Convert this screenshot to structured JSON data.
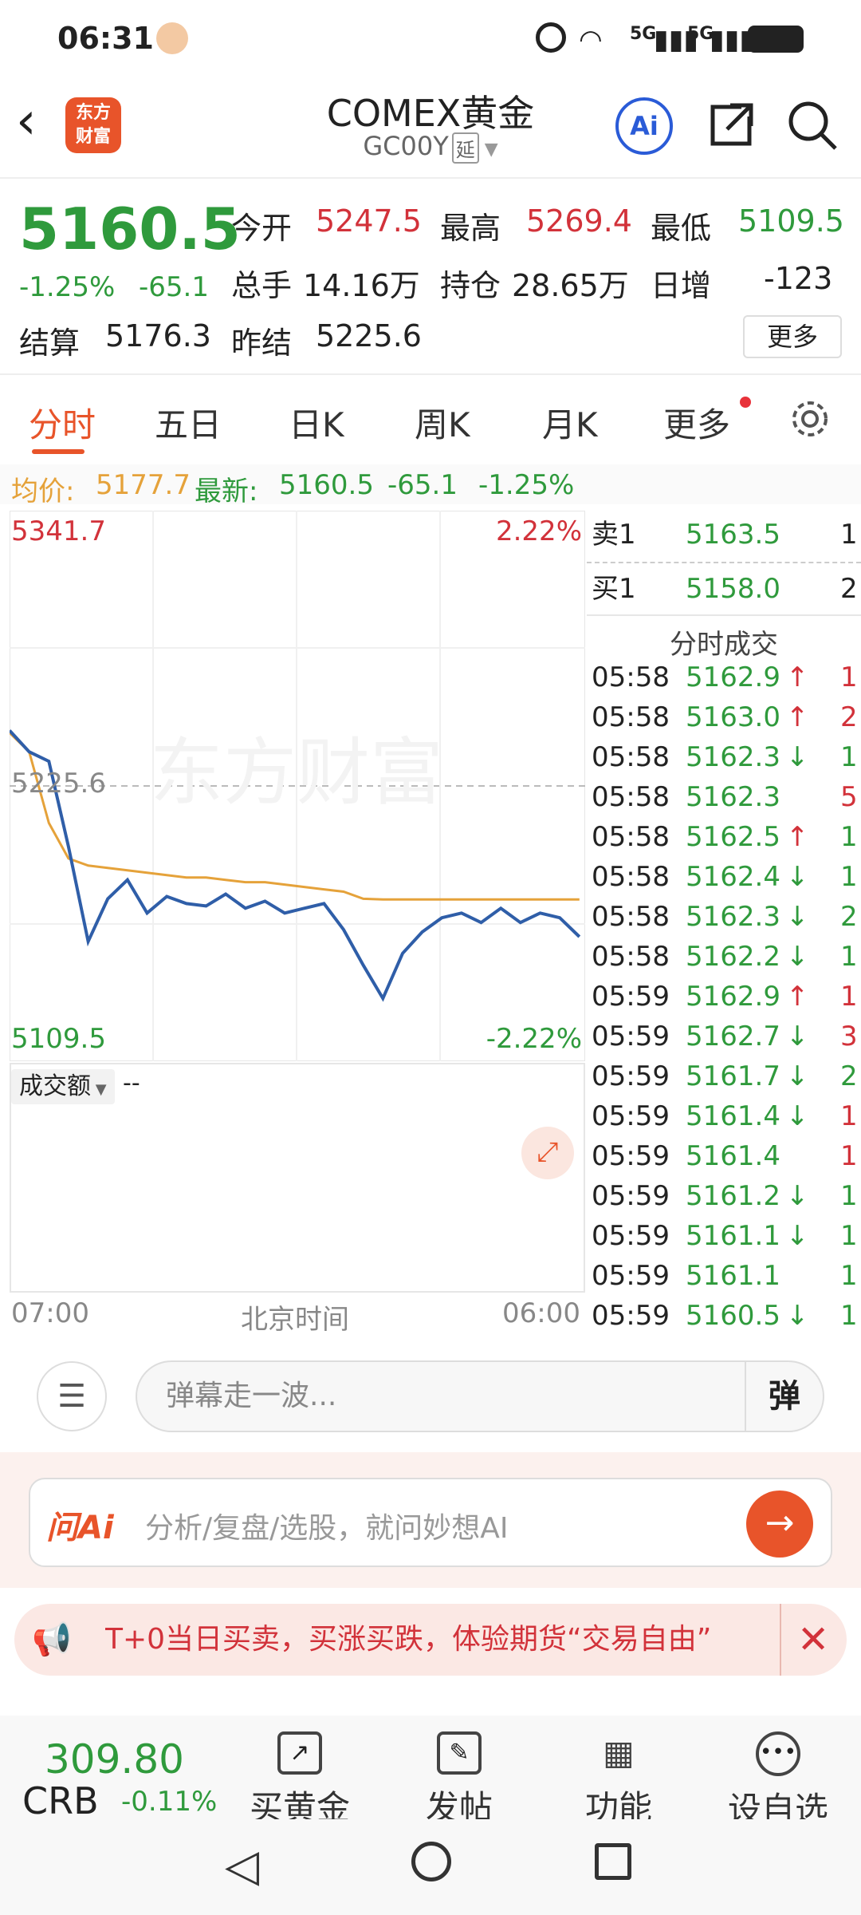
{
  "status_bar": {
    "time": "06:31",
    "signal_tag_1": "5G",
    "signal_tag_2": "5G"
  },
  "header": {
    "logo_text_1": "东方",
    "logo_text_2": "财富",
    "title": "COMEX黄金",
    "code": "GC00Y",
    "delay_tag": "延",
    "ai_label": "Ai"
  },
  "quote": {
    "last": "5160.5",
    "change_pct": "-1.25%",
    "change": "-65.1",
    "open_label": "今开",
    "open": "5247.5",
    "high_label": "最高",
    "high": "5269.4",
    "low_label": "最低",
    "low": "5109.5",
    "volume_label": "总手",
    "volume": "14.16万",
    "oi_label": "持仓",
    "oi": "28.65万",
    "daily_inc_label": "日增",
    "daily_inc": "-123",
    "settle_label": "结算",
    "settle": "5176.3",
    "prev_settle_label": "昨结",
    "prev_settle": "5225.6",
    "more": "更多"
  },
  "tabs": [
    {
      "label": "分时"
    },
    {
      "label": "五日"
    },
    {
      "label": "日K"
    },
    {
      "label": "周K"
    },
    {
      "label": "月K"
    },
    {
      "label": "更多"
    }
  ],
  "avg_line": {
    "avg_label": "均价:",
    "avg": "5177.7",
    "latest_label": "最新:",
    "latest": "5160.5",
    "chg": "-65.1",
    "pct": "-1.25%"
  },
  "chart": {
    "max": "5341.7",
    "max_pct": "2.22%",
    "ref": "5225.6",
    "min": "5109.5",
    "min_pct": "-2.22%",
    "watermark": "东方财富",
    "volume_label": "成交额",
    "volume_value": "--",
    "x_start": "07:00",
    "x_mid": "北京时间",
    "x_end": "06:00"
  },
  "chart_data": {
    "type": "line",
    "x_range": [
      "07:00",
      "06:00"
    ],
    "ylim": [
      5109.5,
      5341.7
    ],
    "reference": 5225.6,
    "series": [
      {
        "name": "最新",
        "values": [
          5249,
          5240,
          5236,
          5200,
          5160,
          5178,
          5186,
          5172,
          5179,
          5176,
          5175,
          5180,
          5174,
          5177,
          5172,
          5174,
          5176,
          5165,
          5150,
          5136,
          5155,
          5164,
          5170,
          5172,
          5168,
          5174,
          5168,
          5172,
          5170,
          5162
        ]
      },
      {
        "name": "均价",
        "values": [
          5248,
          5240,
          5210,
          5195,
          5192,
          5191,
          5190,
          5189,
          5188,
          5187,
          5187,
          5186,
          5185,
          5185,
          5184,
          5183,
          5182,
          5181,
          5178,
          5177.7,
          5177.7,
          5177.7,
          5177.7,
          5177.7,
          5177.7,
          5177.7,
          5177.7,
          5177.7,
          5177.7,
          5177.7
        ]
      }
    ]
  },
  "orderbook": {
    "ask_label": "卖1",
    "ask": "5163.5",
    "ask_vol": "1",
    "bid_label": "买1",
    "bid": "5158.0",
    "bid_vol": "2",
    "trades_title": "分时成交",
    "trades": [
      {
        "t": "05:58",
        "p": "5162.9",
        "d": "↑",
        "v": "1",
        "c": "red"
      },
      {
        "t": "05:58",
        "p": "5163.0",
        "d": "↑",
        "v": "2",
        "c": "red"
      },
      {
        "t": "05:58",
        "p": "5162.3",
        "d": "↓",
        "v": "1",
        "c": "green"
      },
      {
        "t": "05:58",
        "p": "5162.3",
        "d": "",
        "v": "5",
        "c": "red"
      },
      {
        "t": "05:58",
        "p": "5162.5",
        "d": "↑",
        "v": "1",
        "c": "green"
      },
      {
        "t": "05:58",
        "p": "5162.4",
        "d": "↓",
        "v": "1",
        "c": "green"
      },
      {
        "t": "05:58",
        "p": "5162.3",
        "d": "↓",
        "v": "2",
        "c": "green"
      },
      {
        "t": "05:58",
        "p": "5162.2",
        "d": "↓",
        "v": "1",
        "c": "green"
      },
      {
        "t": "05:59",
        "p": "5162.9",
        "d": "↑",
        "v": "1",
        "c": "red"
      },
      {
        "t": "05:59",
        "p": "5162.7",
        "d": "↓",
        "v": "3",
        "c": "red"
      },
      {
        "t": "05:59",
        "p": "5161.7",
        "d": "↓",
        "v": "2",
        "c": "green"
      },
      {
        "t": "05:59",
        "p": "5161.4",
        "d": "↓",
        "v": "1",
        "c": "red"
      },
      {
        "t": "05:59",
        "p": "5161.4",
        "d": "",
        "v": "1",
        "c": "red"
      },
      {
        "t": "05:59",
        "p": "5161.2",
        "d": "↓",
        "v": "1",
        "c": "green"
      },
      {
        "t": "05:59",
        "p": "5161.1",
        "d": "↓",
        "v": "1",
        "c": "green"
      },
      {
        "t": "05:59",
        "p": "5161.1",
        "d": "",
        "v": "1",
        "c": "green"
      },
      {
        "t": "05:59",
        "p": "5160.5",
        "d": "↓",
        "v": "1",
        "c": "green"
      }
    ]
  },
  "chat": {
    "placeholder": "弹幕走一波...",
    "send": "弹"
  },
  "ai": {
    "brand": "问Ai",
    "placeholder": "分析/复盘/选股，就问妙想AI"
  },
  "promo": {
    "text": "T+0当日买卖，买涨买跌，体验期货“交易自由”"
  },
  "bottom_nav": {
    "index_value": "309.80",
    "index_name": "CRB",
    "index_pct": "-0.11%",
    "items": [
      {
        "label": "买黄金"
      },
      {
        "label": "发帖"
      },
      {
        "label": "功能"
      },
      {
        "label": "设自选"
      }
    ]
  },
  "colors": {
    "up": "#d2323a",
    "down": "#2f9a3c",
    "accent": "#e8542a",
    "price_line": "#2f5ea8",
    "avg_line": "#e5a23a"
  }
}
